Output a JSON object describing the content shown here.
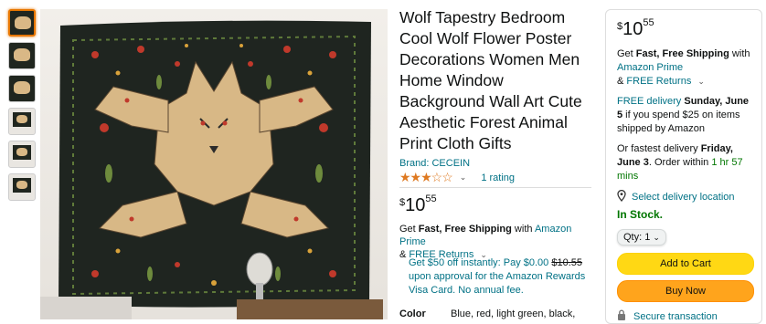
{
  "product": {
    "title": "Wolf Tapestry Bedroom Cool Wolf Flower Poster Decorations Women Men Home Window Background Wall Art Cute Aesthetic Forest Animal Print Cloth Gifts",
    "brand": "Brand: CECEIN",
    "rating_value": 3,
    "rating_max": 5,
    "rating_count": "1 rating",
    "price": {
      "currency": "$",
      "whole": "10",
      "fraction": "55"
    },
    "shipping": {
      "prefix": "Get ",
      "bold": "Fast, Free Shipping",
      "with": " with ",
      "prime": "Amazon Prime",
      "amp": "& ",
      "returns": "FREE Returns"
    },
    "promo": {
      "line1": "Get $50 off instantly: Pay $0.00 ",
      "strike": "$10.55",
      "line2": " upon approval for the Amazon Rewards Visa Card. No annual fee."
    },
    "color_label": "Color",
    "color_value": "Blue, red, light green, black,"
  },
  "buybox": {
    "price": {
      "currency": "$",
      "whole": "10",
      "fraction": "55"
    },
    "shipping_prefix": "Get ",
    "shipping_bold": "Fast, Free Shipping",
    "shipping_with": " with",
    "prime": "Amazon Prime",
    "amp": "& ",
    "returns": "FREE Returns",
    "free_delivery_link": "FREE delivery",
    "free_delivery_date": " Sunday, June 5",
    "free_delivery_rest": " if you spend $25 on items shipped by Amazon",
    "fastest_prefix": "Or fastest delivery ",
    "fastest_date": "Friday, June 3",
    "fastest_mid": ". Order within ",
    "fastest_time": "1 hr 57 mins",
    "location": "Select delivery location",
    "stock": "In Stock.",
    "qty_label": "Qty: 1",
    "add_to_cart": "Add to Cart",
    "buy_now": "Buy Now",
    "secure": "Secure transaction"
  },
  "icons": {
    "share": "share-icon",
    "location": "location-pin-icon",
    "lock": "lock-icon",
    "chevron": "chevron-down-icon"
  },
  "colors": {
    "link": "#007185",
    "star": "#de7921",
    "stock": "#007600",
    "cart_button": "#ffd814",
    "buy_button": "#ffa41c",
    "thumb_selected": "#e77600"
  }
}
